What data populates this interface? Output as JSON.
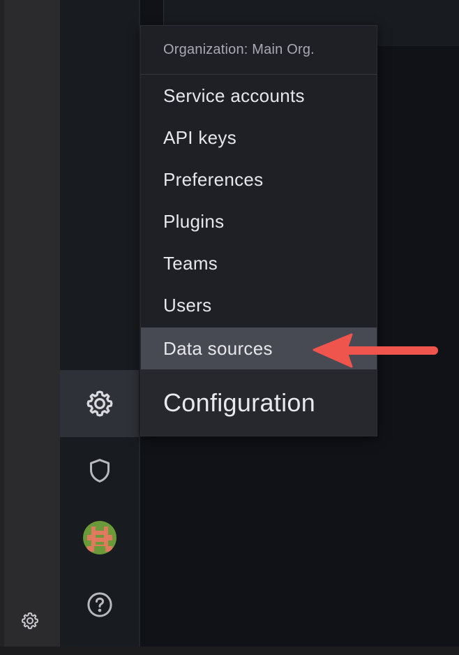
{
  "menu": {
    "header": "Organization: Main Org.",
    "items": [
      {
        "label": "Service accounts"
      },
      {
        "label": "API keys"
      },
      {
        "label": "Preferences"
      },
      {
        "label": "Plugins"
      },
      {
        "label": "Teams"
      },
      {
        "label": "Users"
      },
      {
        "label": "Data sources",
        "highlighted": true
      }
    ],
    "footer_title": "Configuration"
  },
  "sidebar": {
    "items": [
      {
        "icon": "gear-icon",
        "active": true
      },
      {
        "icon": "shield-icon"
      },
      {
        "icon": "avatar"
      },
      {
        "icon": "help-icon"
      }
    ]
  },
  "outer_panel": {
    "icon": "gear-icon"
  },
  "colors": {
    "background": "#111217",
    "sidebar": "#181b1f",
    "menu": "#1e2026",
    "highlight": "#474a53",
    "arrow": "#f0554d"
  }
}
